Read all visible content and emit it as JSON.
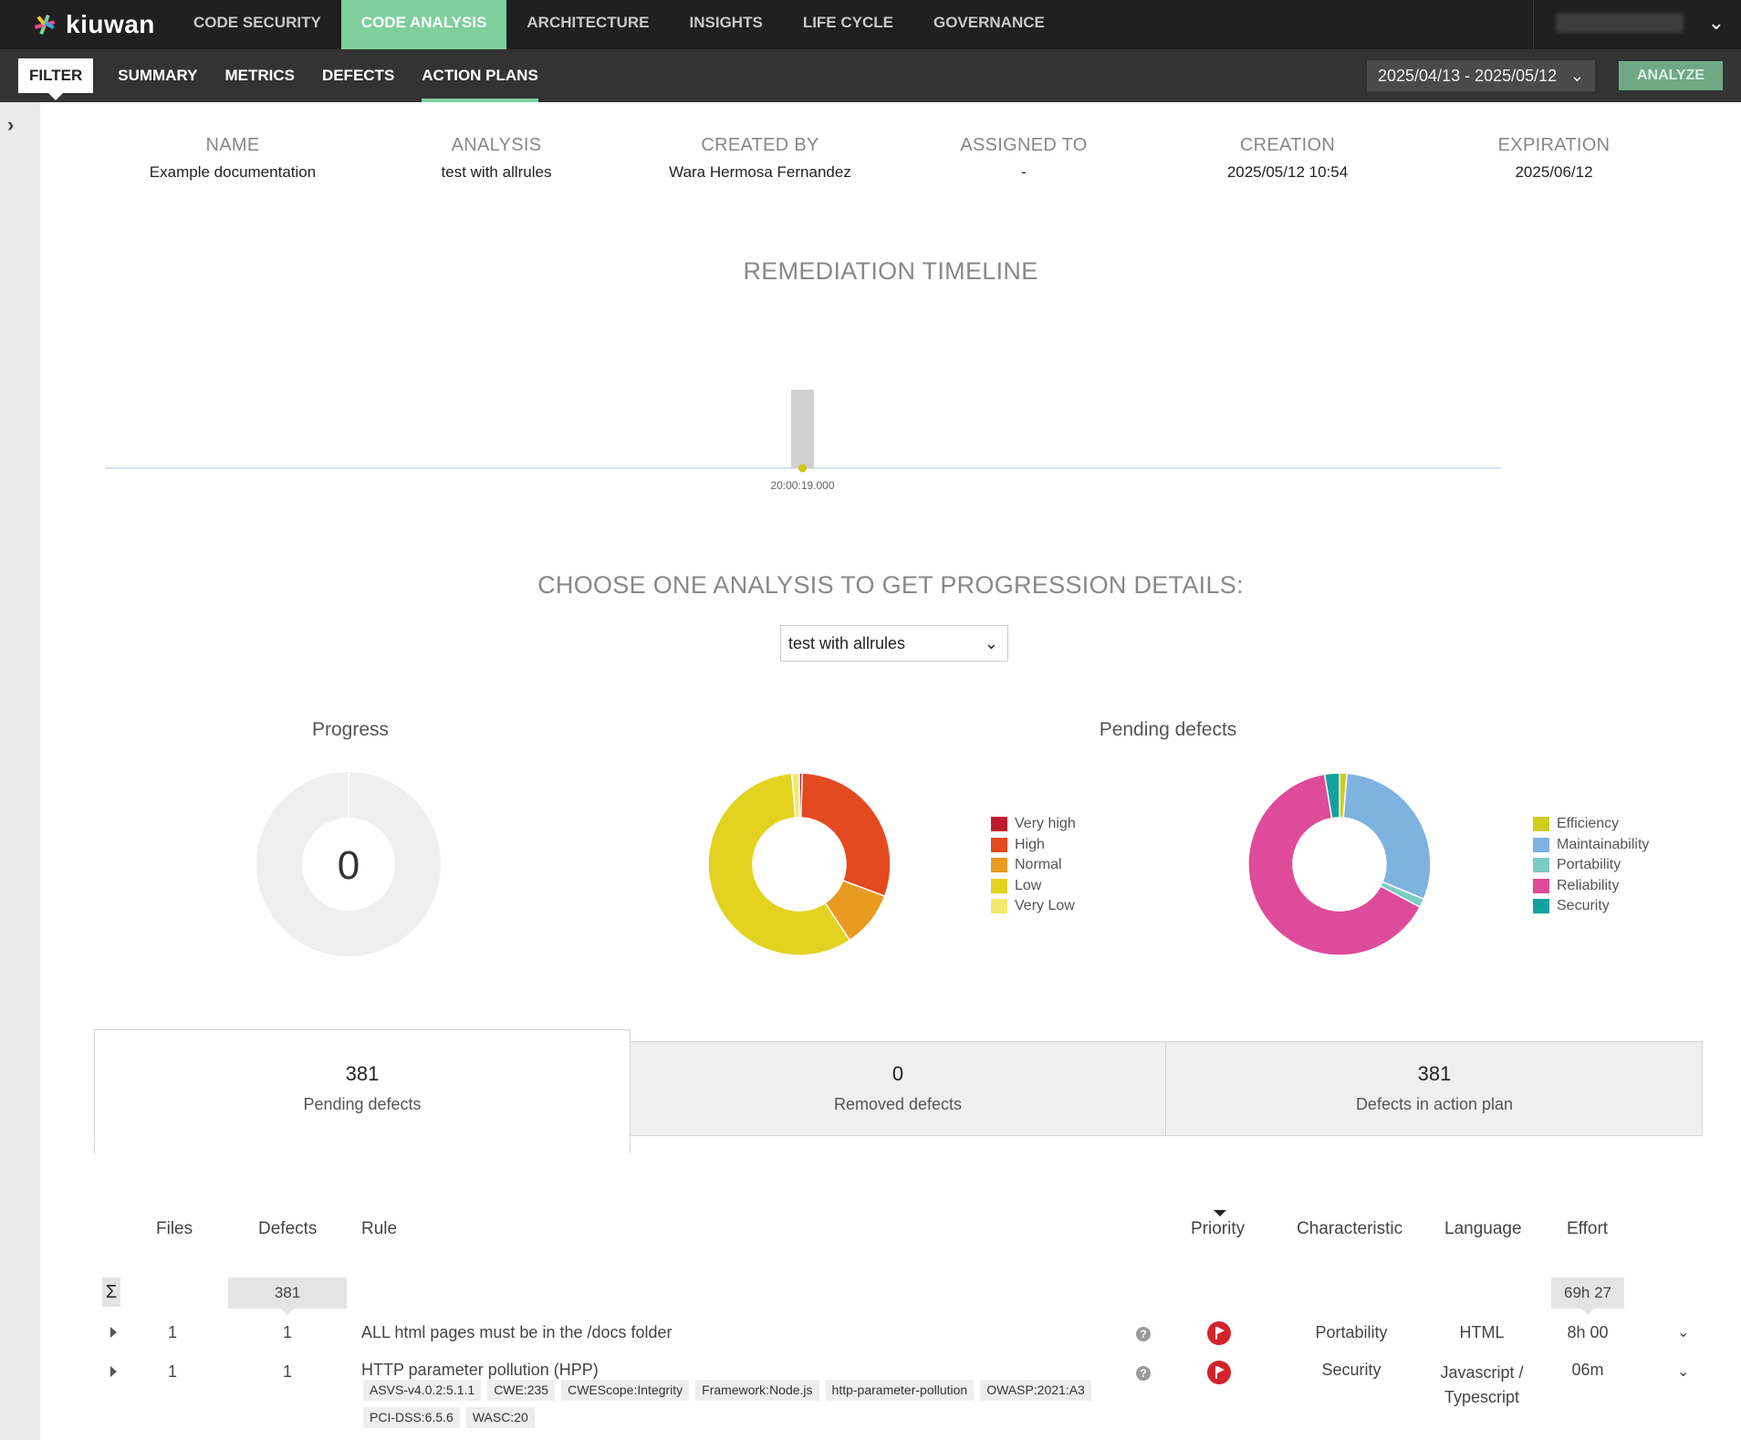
{
  "brand": {
    "name": "kiuwan",
    "accent": "#7fcf9c"
  },
  "top_nav": [
    {
      "label": "CODE SECURITY",
      "active": false
    },
    {
      "label": "CODE ANALYSIS",
      "active": true
    },
    {
      "label": "ARCHITECTURE",
      "active": false
    },
    {
      "label": "INSIGHTS",
      "active": false
    },
    {
      "label": "LIFE CYCLE",
      "active": false
    },
    {
      "label": "GOVERNANCE",
      "active": false
    }
  ],
  "sub_nav": {
    "filter": "FILTER",
    "items": [
      {
        "label": "SUMMARY",
        "active": false
      },
      {
        "label": "METRICS",
        "active": false
      },
      {
        "label": "DEFECTS",
        "active": false
      },
      {
        "label": "ACTION PLANS",
        "active": true
      }
    ],
    "date_range": "2025/04/13 - 2025/05/12",
    "analyze_label": "ANALYZE"
  },
  "plan_info": [
    {
      "label": "NAME",
      "value": "Example documentation"
    },
    {
      "label": "ANALYSIS",
      "value": "test with allrules"
    },
    {
      "label": "CREATED BY",
      "value": "Wara Hermosa Fernandez"
    },
    {
      "label": "ASSIGNED TO",
      "value": "-"
    },
    {
      "label": "CREATION",
      "value": "2025/05/12 10:54"
    },
    {
      "label": "EXPIRATION",
      "value": "2025/06/12"
    }
  ],
  "timeline": {
    "title": "REMEDIATION TIMELINE",
    "tick_label": "20:00:19.000"
  },
  "progression": {
    "title": "CHOOSE ONE ANALYSIS TO GET PROGRESSION DETAILS:",
    "selected_analysis": "test with allrules"
  },
  "chart_data": [
    {
      "type": "pie",
      "title": "Progress",
      "center_label": "0",
      "values": [
        0
      ]
    },
    {
      "type": "pie",
      "title": "Pending defects",
      "categories": [
        "Very high",
        "High",
        "Normal",
        "Low",
        "Very Low"
      ],
      "values": [
        2,
        115,
        38,
        221,
        5
      ],
      "colors": [
        "#c0182c",
        "#e44a20",
        "#e89a21",
        "#e3d21f",
        "#f1e96e"
      ]
    },
    {
      "type": "pie",
      "categories": [
        "Efficiency",
        "Maintainability",
        "Portability",
        "Reliability",
        "Security"
      ],
      "values": [
        5,
        114,
        6,
        246,
        10
      ],
      "colors": [
        "#cfcd1c",
        "#7eb3df",
        "#7ccbc2",
        "#de4b9a",
        "#14a2a0"
      ]
    }
  ],
  "stats": [
    {
      "value": "381",
      "label": "Pending defects",
      "active": true
    },
    {
      "value": "0",
      "label": "Removed defects",
      "active": false
    },
    {
      "value": "381",
      "label": "Defects in action plan",
      "active": false
    }
  ],
  "table": {
    "headers": {
      "files": "Files",
      "defects": "Defects",
      "rule": "Rule",
      "priority": "Priority",
      "characteristic": "Characteristic",
      "language": "Language",
      "effort": "Effort"
    },
    "sum_symbol": "Σ",
    "total_defects": "381",
    "total_effort": "69h 27",
    "rows": [
      {
        "files": "1",
        "defects": "1",
        "rule": "ALL html pages must be in the /docs folder",
        "characteristic": "Portability",
        "language": "HTML",
        "effort": "8h 00",
        "tags": []
      },
      {
        "files": "1",
        "defects": "1",
        "rule": "HTTP parameter pollution (HPP)",
        "characteristic": "Security",
        "language_line1": "Javascript /",
        "language_line2": "Typescript",
        "effort": "06m",
        "tags": [
          "ASVS-v4.0.2:5.1.1",
          "CWE:235",
          "CWEScope:Integrity",
          "Framework:Node.js",
          "http-parameter-pollution",
          "OWASP:2021:A3",
          "PCI-DSS:6.5.6",
          "WASC:20"
        ]
      }
    ]
  }
}
